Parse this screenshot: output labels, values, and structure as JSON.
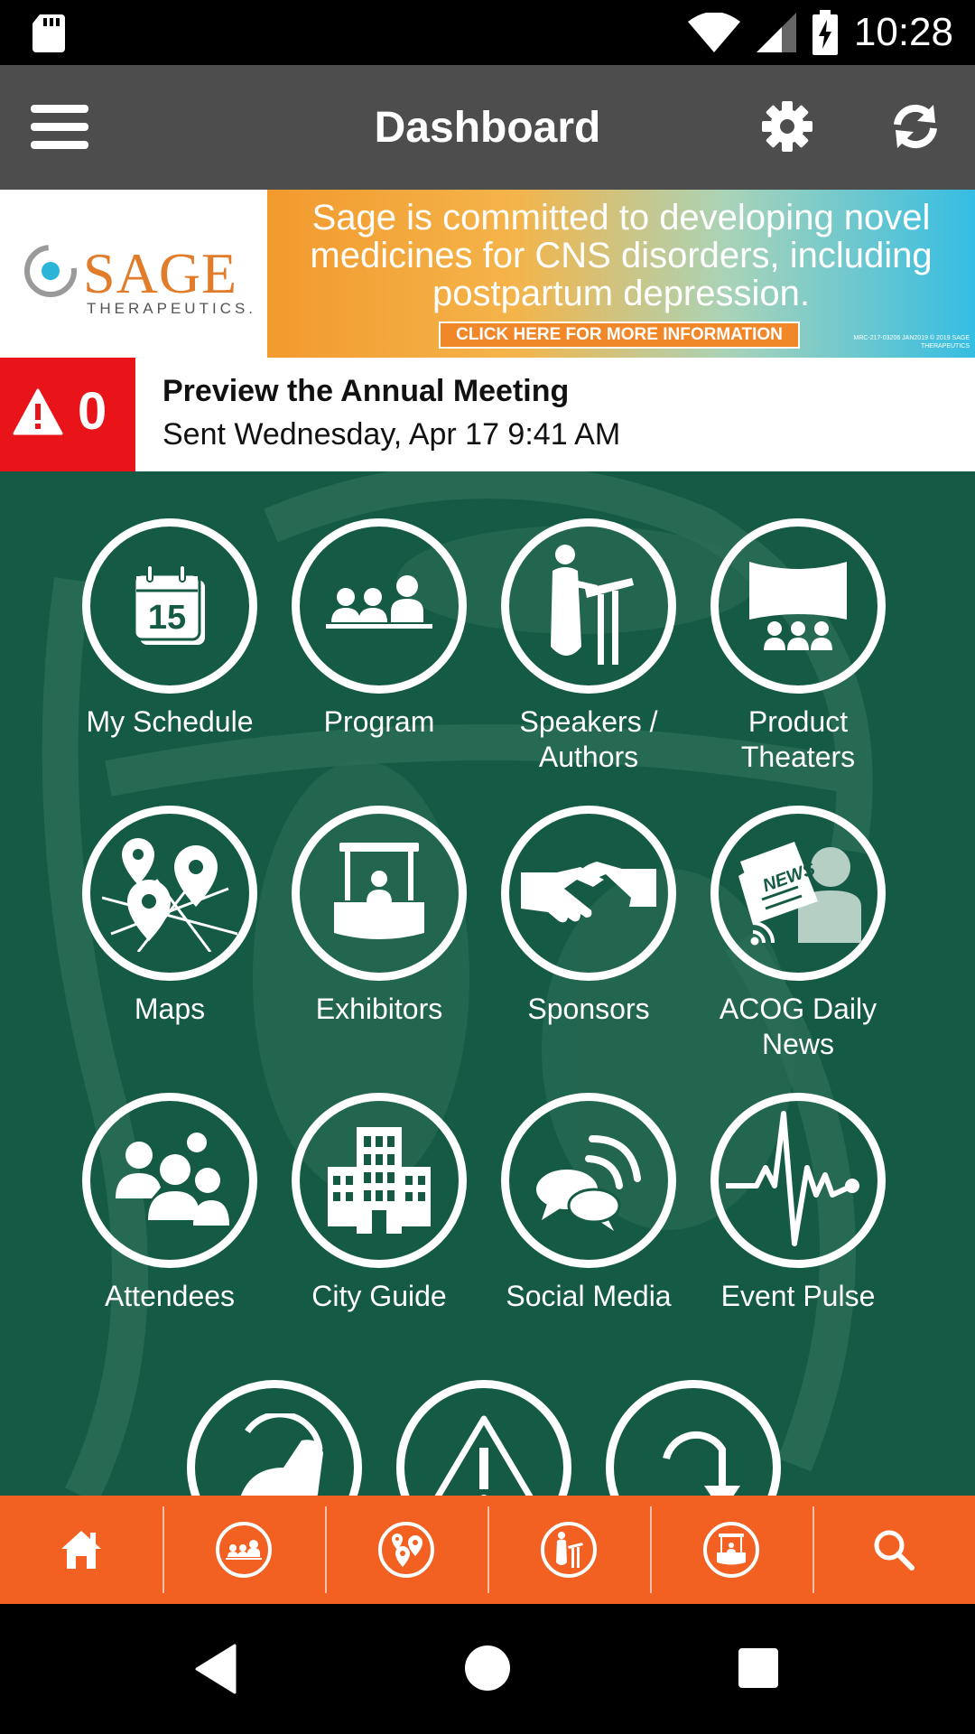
{
  "status_bar": {
    "time": "10:28"
  },
  "app_bar": {
    "title": "Dashboard"
  },
  "banner": {
    "logo_name": "SAGE",
    "logo_sub": "THERAPEUTICS.",
    "message": "Sage is committed to developing novel medicines for CNS disorders, including postpartum depression.",
    "cta": "CLICK HERE FOR MORE INFORMATION",
    "fine_print": "MRC-217-03206 JAN2019 © 2019 SAGE THERAPEUTICS"
  },
  "alert": {
    "count": "0",
    "title": "Preview the Annual Meeting",
    "sent": "Sent Wednesday, Apr 17 9:41 AM"
  },
  "tiles": [
    {
      "label": "My Schedule",
      "icon": "calendar-icon"
    },
    {
      "label": "Program",
      "icon": "audience-icon"
    },
    {
      "label": "Speakers / Authors",
      "icon": "podium-speaker-icon"
    },
    {
      "label": "Product Theaters",
      "icon": "theater-screen-icon"
    },
    {
      "label": "Maps",
      "icon": "map-pins-icon"
    },
    {
      "label": "Exhibitors",
      "icon": "booth-icon"
    },
    {
      "label": "Sponsors",
      "icon": "handshake-icon"
    },
    {
      "label": "ACOG Daily News",
      "icon": "newspaper-icon"
    },
    {
      "label": "Attendees",
      "icon": "people-group-icon"
    },
    {
      "label": "City Guide",
      "icon": "buildings-icon"
    },
    {
      "label": "Social Media",
      "icon": "chat-bubbles-icon"
    },
    {
      "label": "Event Pulse",
      "icon": "heartbeat-icon"
    }
  ],
  "partial_tiles": [
    {
      "icon": "running-shoe-icon"
    },
    {
      "icon": "warning-triangle-icon"
    },
    {
      "icon": "download-arrow-icon"
    }
  ],
  "bottom_nav": [
    {
      "icon": "home-icon"
    },
    {
      "icon": "audience-icon"
    },
    {
      "icon": "map-pins-icon"
    },
    {
      "icon": "podium-speaker-icon"
    },
    {
      "icon": "booth-icon"
    },
    {
      "icon": "search-icon"
    }
  ],
  "colors": {
    "app_bar": "#4d4d4d",
    "main_bg": "#145a45",
    "alert_badge": "#e8141a",
    "bottom_nav": "#f26122"
  }
}
